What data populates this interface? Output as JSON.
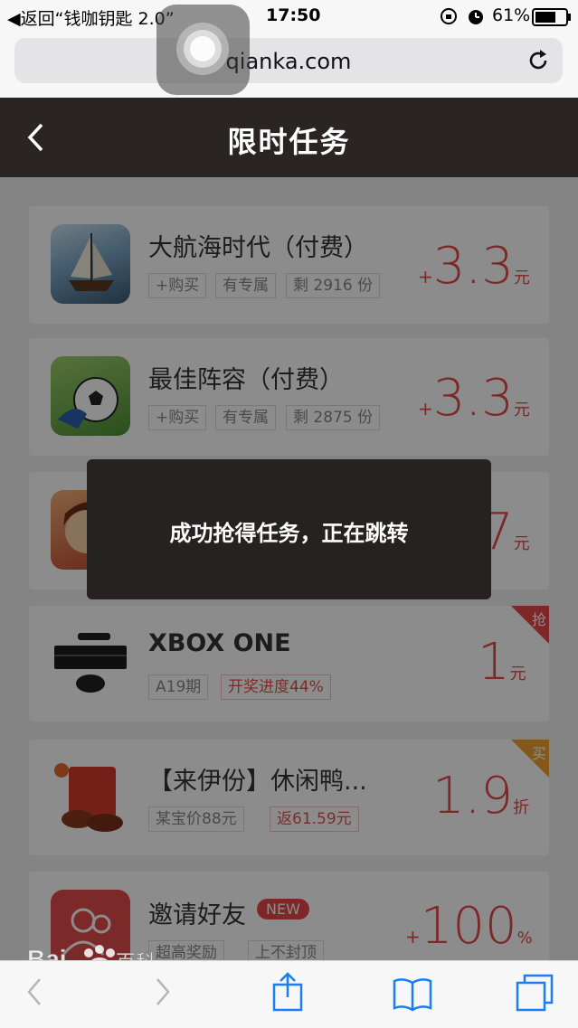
{
  "status_bar": {
    "back_app": "◀返回“钱咖钥匙 2.0”",
    "time": "17:50",
    "battery": "61%"
  },
  "browser": {
    "url": "qianka.com"
  },
  "header": {
    "title": "限时任务"
  },
  "tasks": [
    {
      "title": "大航海时代（付费）",
      "tags": [
        "+购买",
        "有专属",
        "剩 2916 份"
      ],
      "price": {
        "prefix": "+",
        "value": "3.3",
        "unit": "元"
      },
      "icon": "ship-game-icon"
    },
    {
      "title": "最佳阵容（付费）",
      "tags": [
        "+购买",
        "有专属",
        "剩 2875 份"
      ],
      "price": {
        "prefix": "+",
        "value": "3.3",
        "unit": "元"
      },
      "icon": "soccer-game-icon"
    },
    {
      "title": "",
      "tags": [],
      "price": {
        "prefix": "",
        "value": "7",
        "unit": "元"
      },
      "icon": "cartoon-game-icon"
    },
    {
      "title": "XBOX ONE",
      "tags": [
        "A19期",
        "开奖进度44%"
      ],
      "price": {
        "prefix": "",
        "value": "1",
        "unit": "元"
      },
      "corner": "抢",
      "icon": "xbox-console-icon"
    },
    {
      "title": "【来伊份】休闲鸭...",
      "tags": [
        "某宝价88元",
        "返61.59元"
      ],
      "price": {
        "prefix": "",
        "value": "1.9",
        "unit": "折"
      },
      "corner": "买",
      "icon": "snack-product-icon"
    },
    {
      "title": "邀请好友",
      "badge": "NEW",
      "tags": [
        "超高奖励",
        "上不封顶"
      ],
      "price": {
        "prefix": "+",
        "value": "100",
        "unit": "%"
      },
      "icon": "invite-friends-icon"
    }
  ],
  "toast": {
    "message": "成功抢得任务，正在跳转"
  },
  "colors": {
    "header_bg": "#2a2523",
    "price_red": "#e34848",
    "toast_bg": "#252221"
  }
}
